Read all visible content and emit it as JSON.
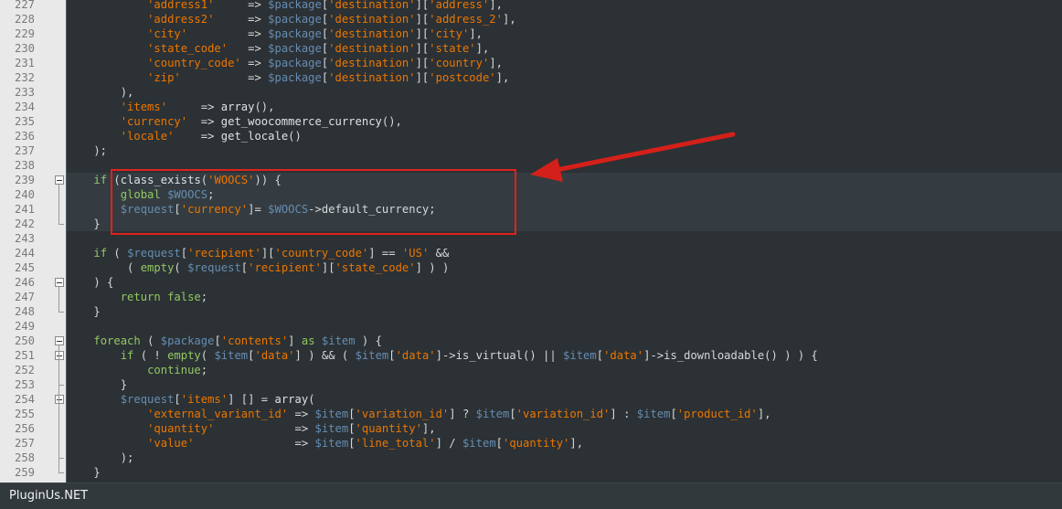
{
  "editor": {
    "lines": [
      {
        "n": "227",
        "fold": "",
        "sel": false,
        "tokens": [
          [
            "k",
            "            "
          ],
          [
            "s",
            "'address1'"
          ],
          [
            "k",
            "     => "
          ],
          [
            "v",
            "$package"
          ],
          [
            "k",
            "["
          ],
          [
            "s",
            "'destination'"
          ],
          [
            "k",
            "]["
          ],
          [
            "s",
            "'address'"
          ],
          [
            "k",
            "],"
          ]
        ]
      },
      {
        "n": "228",
        "fold": "",
        "sel": false,
        "tokens": [
          [
            "k",
            "            "
          ],
          [
            "s",
            "'address2'"
          ],
          [
            "k",
            "     => "
          ],
          [
            "v",
            "$package"
          ],
          [
            "k",
            "["
          ],
          [
            "s",
            "'destination'"
          ],
          [
            "k",
            "]["
          ],
          [
            "s",
            "'address_2'"
          ],
          [
            "k",
            "],"
          ]
        ]
      },
      {
        "n": "229",
        "fold": "",
        "sel": false,
        "tokens": [
          [
            "k",
            "            "
          ],
          [
            "s",
            "'city'"
          ],
          [
            "k",
            "         => "
          ],
          [
            "v",
            "$package"
          ],
          [
            "k",
            "["
          ],
          [
            "s",
            "'destination'"
          ],
          [
            "k",
            "]["
          ],
          [
            "s",
            "'city'"
          ],
          [
            "k",
            "],"
          ]
        ]
      },
      {
        "n": "230",
        "fold": "",
        "sel": false,
        "tokens": [
          [
            "k",
            "            "
          ],
          [
            "s",
            "'state_code'"
          ],
          [
            "k",
            "   => "
          ],
          [
            "v",
            "$package"
          ],
          [
            "k",
            "["
          ],
          [
            "s",
            "'destination'"
          ],
          [
            "k",
            "]["
          ],
          [
            "s",
            "'state'"
          ],
          [
            "k",
            "],"
          ]
        ]
      },
      {
        "n": "231",
        "fold": "",
        "sel": false,
        "tokens": [
          [
            "k",
            "            "
          ],
          [
            "s",
            "'country_code'"
          ],
          [
            "k",
            " => "
          ],
          [
            "v",
            "$package"
          ],
          [
            "k",
            "["
          ],
          [
            "s",
            "'destination'"
          ],
          [
            "k",
            "]["
          ],
          [
            "s",
            "'country'"
          ],
          [
            "k",
            "],"
          ]
        ]
      },
      {
        "n": "232",
        "fold": "",
        "sel": false,
        "tokens": [
          [
            "k",
            "            "
          ],
          [
            "s",
            "'zip'"
          ],
          [
            "k",
            "          => "
          ],
          [
            "v",
            "$package"
          ],
          [
            "k",
            "["
          ],
          [
            "s",
            "'destination'"
          ],
          [
            "k",
            "]["
          ],
          [
            "s",
            "'postcode'"
          ],
          [
            "k",
            "],"
          ]
        ]
      },
      {
        "n": "233",
        "fold": "",
        "sel": false,
        "tokens": [
          [
            "k",
            "        ),"
          ]
        ]
      },
      {
        "n": "234",
        "fold": "",
        "sel": false,
        "tokens": [
          [
            "k",
            "        "
          ],
          [
            "s",
            "'items'"
          ],
          [
            "k",
            "     => "
          ],
          [
            "f",
            "array"
          ],
          [
            "k",
            "(),"
          ]
        ]
      },
      {
        "n": "235",
        "fold": "",
        "sel": false,
        "tokens": [
          [
            "k",
            "        "
          ],
          [
            "s",
            "'currency'"
          ],
          [
            "k",
            "  => "
          ],
          [
            "f",
            "get_woocommerce_currency"
          ],
          [
            "k",
            "(),"
          ]
        ]
      },
      {
        "n": "236",
        "fold": "",
        "sel": false,
        "tokens": [
          [
            "k",
            "        "
          ],
          [
            "s",
            "'locale'"
          ],
          [
            "k",
            "    => "
          ],
          [
            "f",
            "get_locale"
          ],
          [
            "k",
            "()"
          ]
        ]
      },
      {
        "n": "237",
        "fold": "",
        "sel": false,
        "tokens": [
          [
            "k",
            "    );"
          ]
        ]
      },
      {
        "n": "238",
        "fold": "",
        "sel": false,
        "tokens": [
          [
            "k",
            ""
          ]
        ]
      },
      {
        "n": "239",
        "fold": "open",
        "sel": true,
        "tokens": [
          [
            "k",
            "    "
          ],
          [
            "kn",
            "if"
          ],
          [
            "k",
            " ("
          ],
          [
            "f",
            "class_exists"
          ],
          [
            "k",
            "("
          ],
          [
            "s",
            "'WOOCS'"
          ],
          [
            "k",
            ")) {"
          ]
        ]
      },
      {
        "n": "240",
        "fold": "",
        "sel": true,
        "tokens": [
          [
            "k",
            "        "
          ],
          [
            "kn",
            "global"
          ],
          [
            "k",
            " "
          ],
          [
            "v",
            "$WOOCS"
          ],
          [
            "k",
            ";"
          ]
        ]
      },
      {
        "n": "241",
        "fold": "",
        "sel": true,
        "tokens": [
          [
            "k",
            "        "
          ],
          [
            "v",
            "$request"
          ],
          [
            "k",
            "["
          ],
          [
            "s",
            "'currency'"
          ],
          [
            "k",
            "]= "
          ],
          [
            "v",
            "$WOOCS"
          ],
          [
            "k",
            "->default_currency;"
          ]
        ]
      },
      {
        "n": "242",
        "fold": "end",
        "sel": true,
        "tokens": [
          [
            "k",
            "    }"
          ]
        ]
      },
      {
        "n": "243",
        "fold": "",
        "sel": false,
        "tokens": [
          [
            "k",
            ""
          ]
        ]
      },
      {
        "n": "244",
        "fold": "",
        "sel": false,
        "tokens": [
          [
            "k",
            "    "
          ],
          [
            "kn",
            "if"
          ],
          [
            "k",
            " ( "
          ],
          [
            "v",
            "$request"
          ],
          [
            "k",
            "["
          ],
          [
            "s",
            "'recipient'"
          ],
          [
            "k",
            "]["
          ],
          [
            "s",
            "'country_code'"
          ],
          [
            "k",
            "] == "
          ],
          [
            "s",
            "'US'"
          ],
          [
            "k",
            " &&"
          ]
        ]
      },
      {
        "n": "245",
        "fold": "",
        "sel": false,
        "tokens": [
          [
            "k",
            "         ( "
          ],
          [
            "kn",
            "empty"
          ],
          [
            "k",
            "( "
          ],
          [
            "v",
            "$request"
          ],
          [
            "k",
            "["
          ],
          [
            "s",
            "'recipient'"
          ],
          [
            "k",
            "]["
          ],
          [
            "s",
            "'state_code'"
          ],
          [
            "k",
            "] ) )"
          ]
        ]
      },
      {
        "n": "246",
        "fold": "open",
        "sel": false,
        "tokens": [
          [
            "k",
            "    ) {"
          ]
        ]
      },
      {
        "n": "247",
        "fold": "",
        "sel": false,
        "tokens": [
          [
            "k",
            "        "
          ],
          [
            "kn",
            "return"
          ],
          [
            "k",
            " "
          ],
          [
            "kn",
            "false"
          ],
          [
            "k",
            ";"
          ]
        ]
      },
      {
        "n": "248",
        "fold": "end",
        "sel": false,
        "tokens": [
          [
            "k",
            "    }"
          ]
        ]
      },
      {
        "n": "249",
        "fold": "",
        "sel": false,
        "tokens": [
          [
            "k",
            ""
          ]
        ]
      },
      {
        "n": "250",
        "fold": "open",
        "sel": false,
        "tokens": [
          [
            "k",
            "    "
          ],
          [
            "kn",
            "foreach"
          ],
          [
            "k",
            " ( "
          ],
          [
            "v",
            "$package"
          ],
          [
            "k",
            "["
          ],
          [
            "s",
            "'contents'"
          ],
          [
            "k",
            "] "
          ],
          [
            "kn",
            "as"
          ],
          [
            "k",
            " "
          ],
          [
            "v",
            "$item"
          ],
          [
            "k",
            " ) {"
          ]
        ]
      },
      {
        "n": "251",
        "fold": "open",
        "sel": false,
        "tokens": [
          [
            "k",
            "        "
          ],
          [
            "kn",
            "if"
          ],
          [
            "k",
            " ( ! "
          ],
          [
            "kn",
            "empty"
          ],
          [
            "k",
            "( "
          ],
          [
            "v",
            "$item"
          ],
          [
            "k",
            "["
          ],
          [
            "s",
            "'data'"
          ],
          [
            "k",
            "] ) && ( "
          ],
          [
            "v",
            "$item"
          ],
          [
            "k",
            "["
          ],
          [
            "s",
            "'data'"
          ],
          [
            "k",
            "]->is_virtual() || "
          ],
          [
            "v",
            "$item"
          ],
          [
            "k",
            "["
          ],
          [
            "s",
            "'data'"
          ],
          [
            "k",
            "]->is_downloadable() ) ) {"
          ]
        ]
      },
      {
        "n": "252",
        "fold": "",
        "sel": false,
        "tokens": [
          [
            "k",
            "            "
          ],
          [
            "kn",
            "continue"
          ],
          [
            "k",
            ";"
          ]
        ]
      },
      {
        "n": "253",
        "fold": "end",
        "sel": false,
        "tokens": [
          [
            "k",
            "        }"
          ]
        ]
      },
      {
        "n": "254",
        "fold": "open",
        "sel": false,
        "tokens": [
          [
            "k",
            "        "
          ],
          [
            "v",
            "$request"
          ],
          [
            "k",
            "["
          ],
          [
            "s",
            "'items'"
          ],
          [
            "k",
            "] [] = "
          ],
          [
            "f",
            "array"
          ],
          [
            "k",
            "("
          ]
        ]
      },
      {
        "n": "255",
        "fold": "",
        "sel": false,
        "tokens": [
          [
            "k",
            "            "
          ],
          [
            "s",
            "'external_variant_id'"
          ],
          [
            "k",
            " => "
          ],
          [
            "v",
            "$item"
          ],
          [
            "k",
            "["
          ],
          [
            "s",
            "'variation_id'"
          ],
          [
            "k",
            "] ? "
          ],
          [
            "v",
            "$item"
          ],
          [
            "k",
            "["
          ],
          [
            "s",
            "'variation_id'"
          ],
          [
            "k",
            "] : "
          ],
          [
            "v",
            "$item"
          ],
          [
            "k",
            "["
          ],
          [
            "s",
            "'product_id'"
          ],
          [
            "k",
            "],"
          ]
        ]
      },
      {
        "n": "256",
        "fold": "",
        "sel": false,
        "tokens": [
          [
            "k",
            "            "
          ],
          [
            "s",
            "'quantity'"
          ],
          [
            "k",
            "            => "
          ],
          [
            "v",
            "$item"
          ],
          [
            "k",
            "["
          ],
          [
            "s",
            "'quantity'"
          ],
          [
            "k",
            "],"
          ]
        ]
      },
      {
        "n": "257",
        "fold": "",
        "sel": false,
        "tokens": [
          [
            "k",
            "            "
          ],
          [
            "s",
            "'value'"
          ],
          [
            "k",
            "               => "
          ],
          [
            "v",
            "$item"
          ],
          [
            "k",
            "["
          ],
          [
            "s",
            "'line_total'"
          ],
          [
            "k",
            "] / "
          ],
          [
            "v",
            "$item"
          ],
          [
            "k",
            "["
          ],
          [
            "s",
            "'quantity'"
          ],
          [
            "k",
            "],"
          ]
        ]
      },
      {
        "n": "258",
        "fold": "end",
        "sel": false,
        "tokens": [
          [
            "k",
            "        );"
          ]
        ]
      },
      {
        "n": "259",
        "fold": "end",
        "sel": false,
        "tokens": [
          [
            "k",
            "    }"
          ]
        ]
      }
    ]
  },
  "statusbar": {
    "brand": "PluginUs.NET"
  },
  "annotation": {
    "box_color": "#e0211a",
    "arrow_color": "#d4201a"
  }
}
